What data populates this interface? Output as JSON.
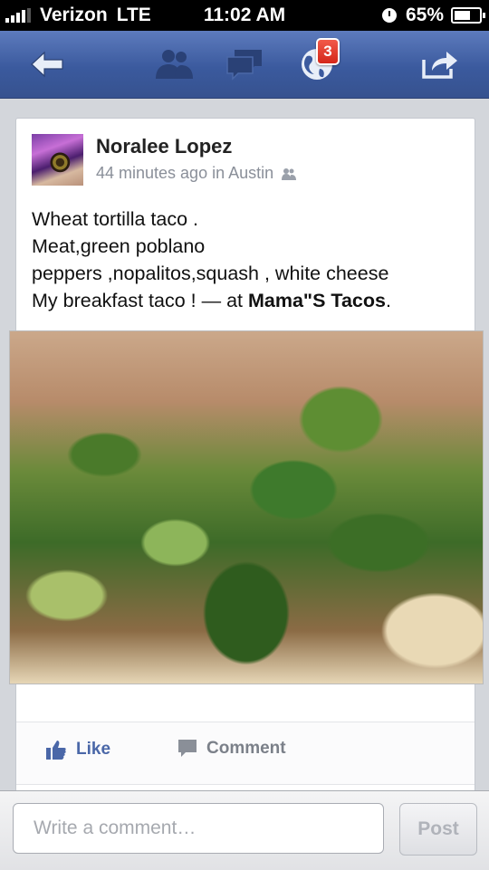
{
  "status_bar": {
    "carrier": "Verizon",
    "network": "LTE",
    "time": "11:02 AM",
    "battery": "65%"
  },
  "nav": {
    "back_icon": "back-arrow-icon",
    "friend_requests_icon": "friends-icon",
    "messages_icon": "messages-icon",
    "notifications_icon": "globe-icon",
    "notifications_count": "3",
    "share_icon": "share-icon"
  },
  "post": {
    "author": "Noralee Lopez",
    "meta": "44 minutes ago in Austin",
    "privacy_icon": "friends-icon",
    "text_lines": [
      "Wheat tortilla taco .",
      "Meat,green poblano",
      "peppers ,nopalitos,squash , white cheese",
      "My breakfast taco ! — at "
    ],
    "place": "Mama\"S Tacos",
    "place_suffix": "."
  },
  "actions": {
    "like": "Like",
    "comment": "Comment"
  },
  "comment_bar": {
    "placeholder": "Write a comment…",
    "post": "Post"
  },
  "colors": {
    "nav_blue": "#3b5a9e",
    "link_blue": "#4a67a8",
    "badge_red": "#d42719"
  }
}
